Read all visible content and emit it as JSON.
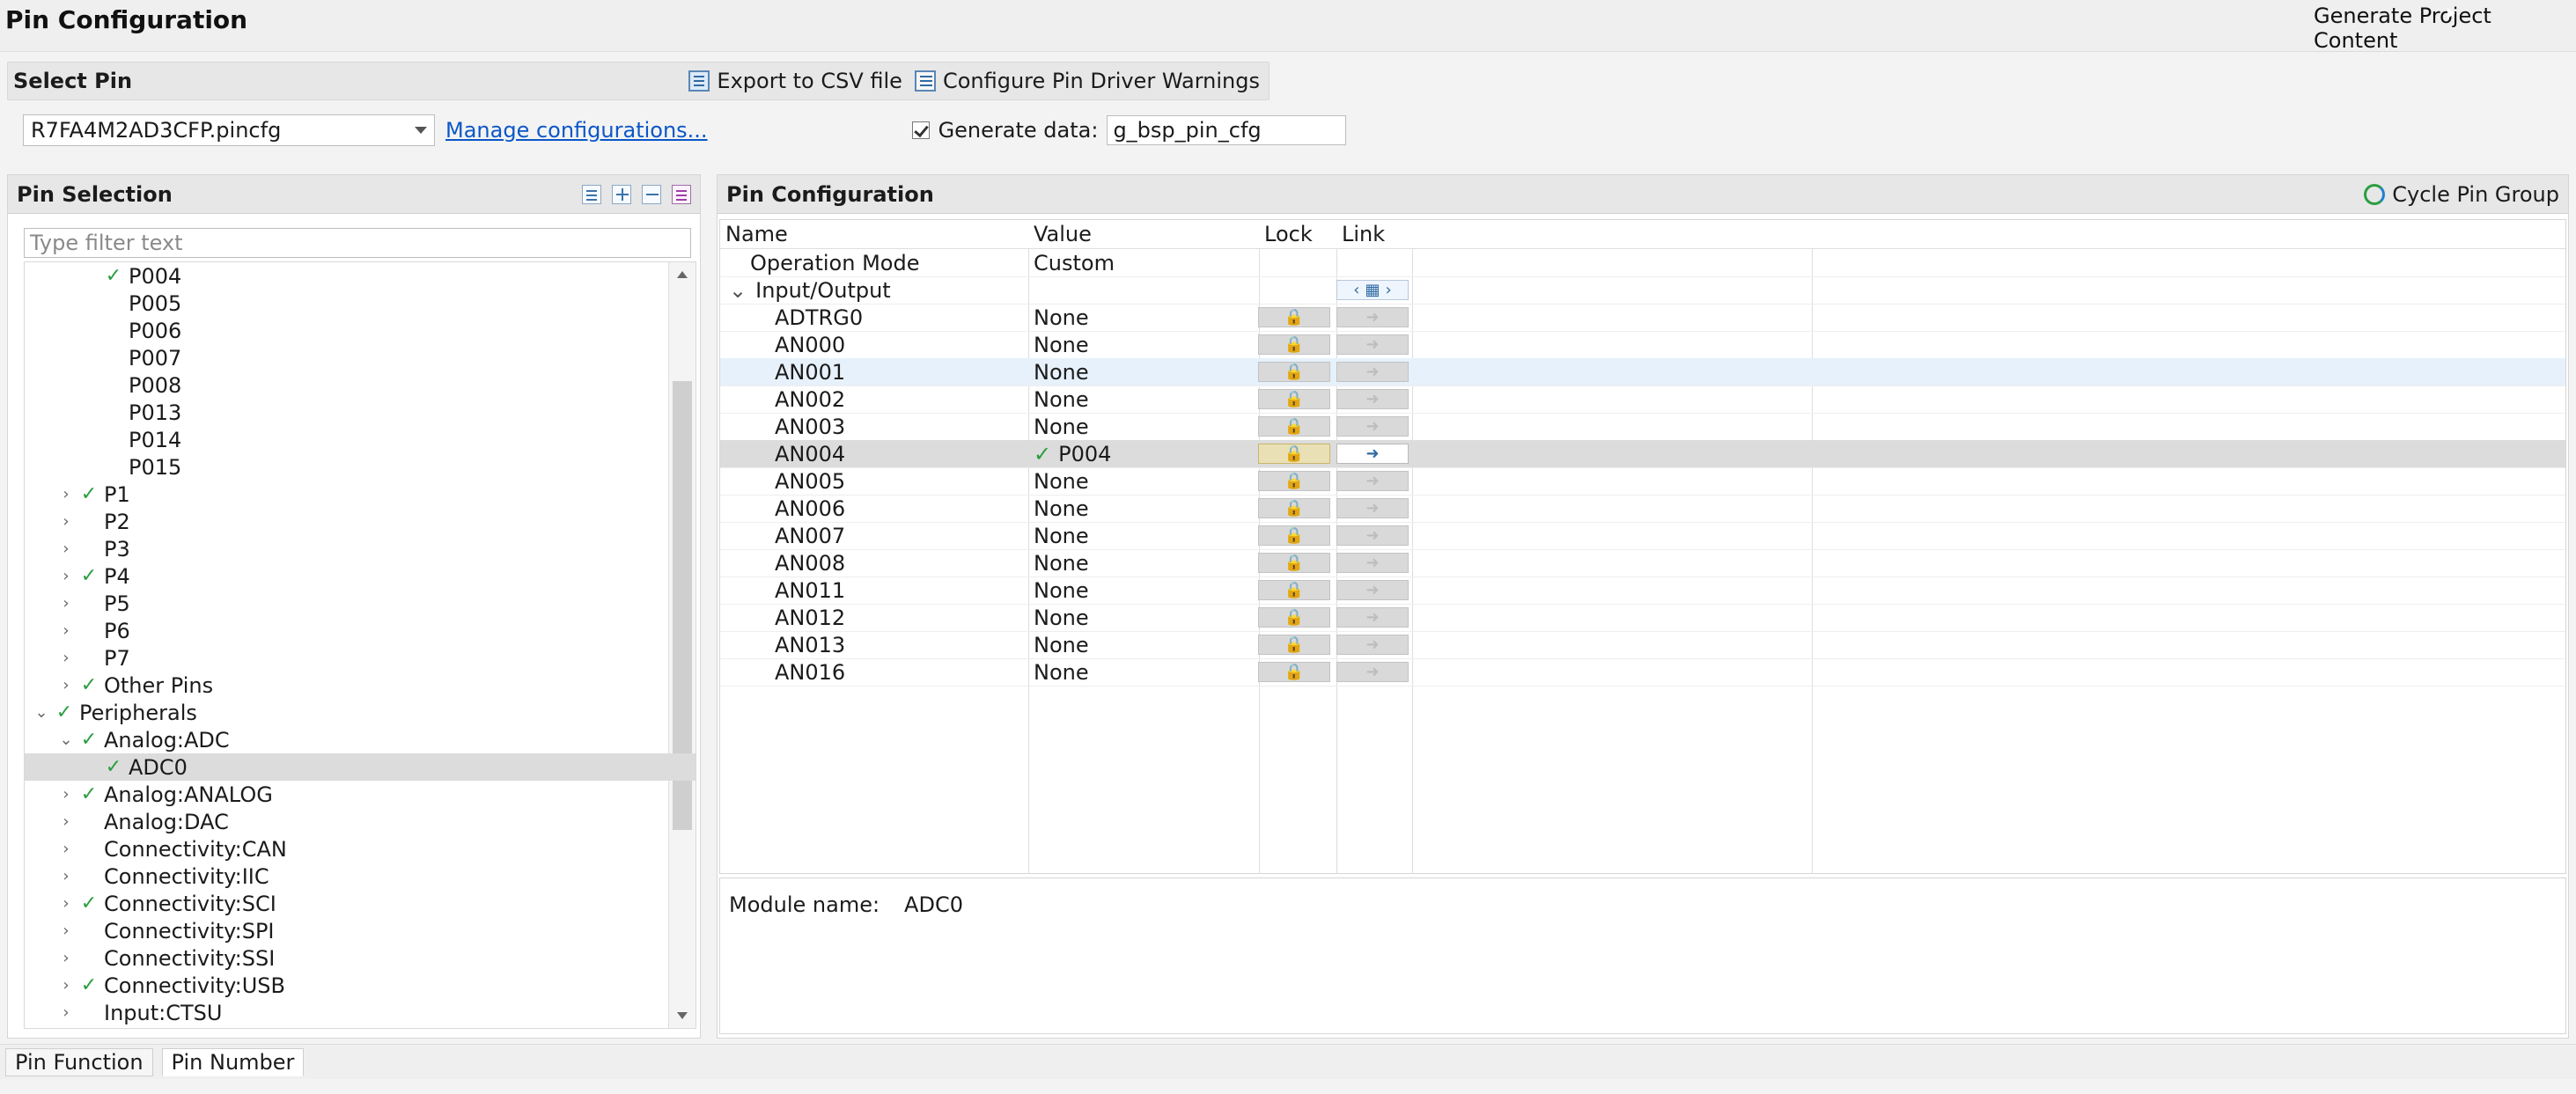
{
  "window": {
    "title": "Pin Configuration",
    "generate_button": "Generate Project Content"
  },
  "select_pin": {
    "title": "Select Pin",
    "export_csv": "Export to CSV file",
    "configure_warnings": "Configure Pin Driver Warnings",
    "config_file": "R7FA4M2AD3CFP.pincfg",
    "manage_configs": "Manage configurations...",
    "generate_data_label": "Generate data:",
    "generate_data_value": "g_bsp_pin_cfg",
    "generate_data_checked": true
  },
  "pin_selection": {
    "title": "Pin Selection",
    "filter_placeholder": "Type filter text",
    "tree": [
      {
        "label": "P004",
        "level": 3,
        "checked": true,
        "twisty": "none"
      },
      {
        "label": "P005",
        "level": 3,
        "checked": false,
        "twisty": "none"
      },
      {
        "label": "P006",
        "level": 3,
        "checked": false,
        "twisty": "none"
      },
      {
        "label": "P007",
        "level": 3,
        "checked": false,
        "twisty": "none"
      },
      {
        "label": "P008",
        "level": 3,
        "checked": false,
        "twisty": "none"
      },
      {
        "label": "P013",
        "level": 3,
        "checked": false,
        "twisty": "none"
      },
      {
        "label": "P014",
        "level": 3,
        "checked": false,
        "twisty": "none"
      },
      {
        "label": "P015",
        "level": 3,
        "checked": false,
        "twisty": "none"
      },
      {
        "label": "P1",
        "level": 2,
        "checked": true,
        "twisty": "collapsed"
      },
      {
        "label": "P2",
        "level": 2,
        "checked": false,
        "twisty": "collapsed"
      },
      {
        "label": "P3",
        "level": 2,
        "checked": false,
        "twisty": "collapsed"
      },
      {
        "label": "P4",
        "level": 2,
        "checked": true,
        "twisty": "collapsed"
      },
      {
        "label": "P5",
        "level": 2,
        "checked": false,
        "twisty": "collapsed"
      },
      {
        "label": "P6",
        "level": 2,
        "checked": false,
        "twisty": "collapsed"
      },
      {
        "label": "P7",
        "level": 2,
        "checked": false,
        "twisty": "collapsed"
      },
      {
        "label": "Other Pins",
        "level": 2,
        "checked": true,
        "twisty": "collapsed"
      },
      {
        "label": "Peripherals",
        "level": 1,
        "checked": true,
        "twisty": "expanded"
      },
      {
        "label": "Analog:ADC",
        "level": 2,
        "checked": true,
        "twisty": "expanded"
      },
      {
        "label": "ADC0",
        "level": 3,
        "checked": true,
        "twisty": "none",
        "selected": true
      },
      {
        "label": "Analog:ANALOG",
        "level": 2,
        "checked": true,
        "twisty": "collapsed"
      },
      {
        "label": "Analog:DAC",
        "level": 2,
        "checked": false,
        "twisty": "collapsed"
      },
      {
        "label": "Connectivity:CAN",
        "level": 2,
        "checked": false,
        "twisty": "collapsed"
      },
      {
        "label": "Connectivity:IIC",
        "level": 2,
        "checked": false,
        "twisty": "collapsed"
      },
      {
        "label": "Connectivity:SCI",
        "level": 2,
        "checked": true,
        "twisty": "collapsed"
      },
      {
        "label": "Connectivity:SPI",
        "level": 2,
        "checked": false,
        "twisty": "collapsed"
      },
      {
        "label": "Connectivity:SSI",
        "level": 2,
        "checked": false,
        "twisty": "collapsed"
      },
      {
        "label": "Connectivity:USB",
        "level": 2,
        "checked": true,
        "twisty": "collapsed"
      },
      {
        "label": "Input:CTSU",
        "level": 2,
        "checked": false,
        "twisty": "collapsed"
      }
    ]
  },
  "pin_configuration": {
    "title": "Pin Configuration",
    "cycle_pin_group": "Cycle Pin Group",
    "columns": {
      "name": "Name",
      "value": "Value",
      "lock": "Lock",
      "link": "Link"
    },
    "rows": [
      {
        "name": "Operation Mode",
        "value": "Custom",
        "kind": "top"
      },
      {
        "name": "Input/Output",
        "value": "",
        "kind": "group"
      },
      {
        "name": "ADTRG0",
        "value": "None",
        "kind": "pin"
      },
      {
        "name": "AN000",
        "value": "None",
        "kind": "pin"
      },
      {
        "name": "AN001",
        "value": "None",
        "kind": "pin",
        "hover": true
      },
      {
        "name": "AN002",
        "value": "None",
        "kind": "pin"
      },
      {
        "name": "AN003",
        "value": "None",
        "kind": "pin"
      },
      {
        "name": "AN004",
        "value": "P004",
        "kind": "pin",
        "selected": true,
        "checked": true,
        "lock_on": true,
        "link_on": true
      },
      {
        "name": "AN005",
        "value": "None",
        "kind": "pin"
      },
      {
        "name": "AN006",
        "value": "None",
        "kind": "pin"
      },
      {
        "name": "AN007",
        "value": "None",
        "kind": "pin"
      },
      {
        "name": "AN008",
        "value": "None",
        "kind": "pin"
      },
      {
        "name": "AN011",
        "value": "None",
        "kind": "pin"
      },
      {
        "name": "AN012",
        "value": "None",
        "kind": "pin"
      },
      {
        "name": "AN013",
        "value": "None",
        "kind": "pin"
      },
      {
        "name": "AN016",
        "value": "None",
        "kind": "pin"
      }
    ],
    "module_name_label": "Module name:",
    "module_name_value": "ADC0"
  },
  "bottom_tabs": {
    "pin_function": "Pin Function",
    "pin_number": "Pin Number",
    "active": "Pin Number"
  }
}
